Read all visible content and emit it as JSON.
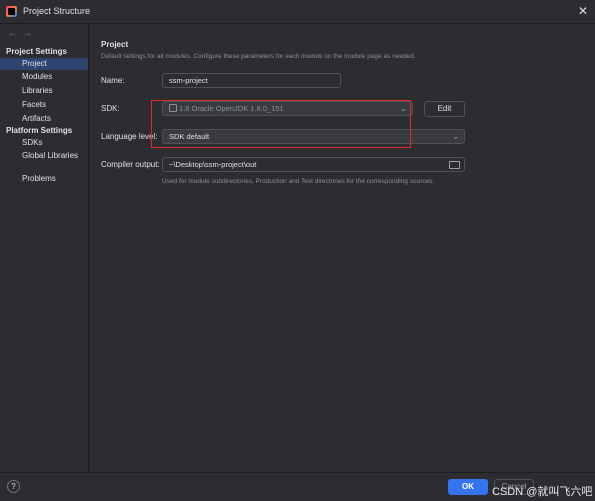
{
  "window": {
    "title": "Project Structure",
    "close_glyph": "✕"
  },
  "nav": {
    "back_glyph": "←",
    "forward_glyph": "→"
  },
  "sidebar": {
    "project_settings_title": "Project Settings",
    "project_items": [
      "Project",
      "Modules",
      "Libraries",
      "Facets",
      "Artifacts"
    ],
    "platform_settings_title": "Platform Settings",
    "platform_items": [
      "SDKs",
      "Global Libraries"
    ],
    "problems": "Problems",
    "selected": "Project"
  },
  "project": {
    "title": "Project",
    "description": "Default settings for all modules. Configure these parameters for each module on the module page as needed.",
    "name_label": "Name:",
    "name_value": "ssm-project",
    "sdk_label": "SDK:",
    "sdk_version": "1.8",
    "sdk_vendor": "Oracle OpenJDK 1.8.0_151",
    "edit_button": "Edit",
    "language_level_label": "Language level:",
    "language_level_value": "SDK default",
    "compiler_output_label": "Compiler output:",
    "compiler_output_value": "~\\Desktop\\ssm-project\\out",
    "compiler_output_hint": "Used for module subdirectories, Production and Test directories for the corresponding sources."
  },
  "footer": {
    "help_glyph": "?",
    "ok_label": "OK",
    "cancel_label": "Cancel",
    "watermark": "CSDN @就叫飞六吧"
  },
  "colors": {
    "accent": "#3574f0",
    "selection": "#2e436e",
    "highlight_box": "#e02a2a",
    "background": "#2b2d30"
  }
}
